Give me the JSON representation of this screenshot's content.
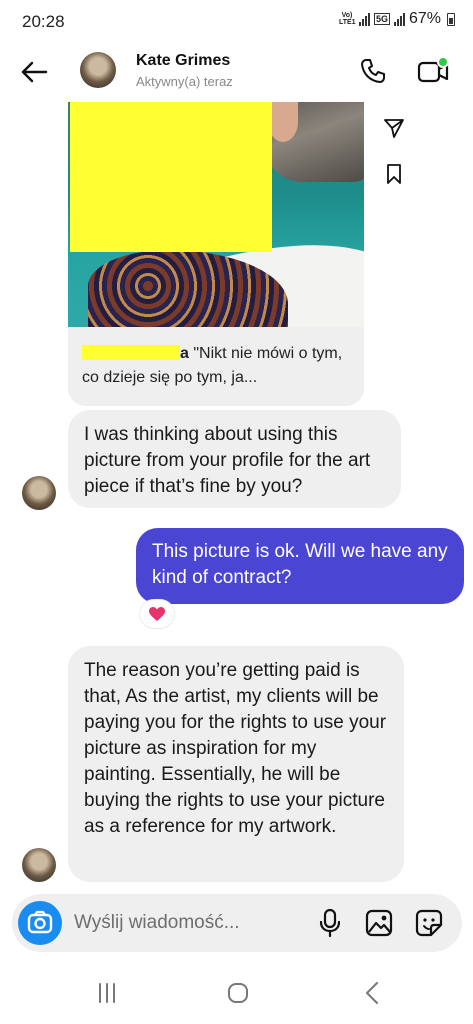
{
  "status_bar": {
    "time": "20:28",
    "volte": "Vo) LTE1",
    "network": "5G",
    "battery": "67%"
  },
  "header": {
    "name": "Kate Grimes",
    "status": "Aktywny(a) teraz"
  },
  "shared_post": {
    "caption_user_suffix": "a",
    "caption_text": " \"Nikt nie mówi o tym, co dzieje się po tym, ja..."
  },
  "messages": [
    {
      "sender": "contact",
      "text": "I was thinking about using this picture from your profile for the art piece if that’s fine by you?"
    },
    {
      "sender": "me",
      "text": "This picture is ok. Will we have any kind of contract?",
      "reaction": "heart"
    },
    {
      "sender": "contact",
      "text": "The reason you’re getting paid is that, As the artist, my clients will be paying you for the rights to use your picture as inspiration for my painting. Essentially, he will be buying the rights to use your picture as a reference for my artwork."
    }
  ],
  "composer": {
    "placeholder": "Wyślij wiadomość..."
  },
  "colors": {
    "outgoing_bubble": "#4b45d4",
    "incoming_bubble": "#efefef",
    "camera_button": "#1a8cf0",
    "active_dot": "#2ecc40",
    "reaction_heart": "#e8336b",
    "censor": "#ffff33"
  },
  "icons": [
    "back-arrow",
    "phone",
    "video-camera",
    "send",
    "bookmark",
    "camera",
    "microphone",
    "gallery",
    "sticker",
    "recents",
    "home",
    "back"
  ]
}
